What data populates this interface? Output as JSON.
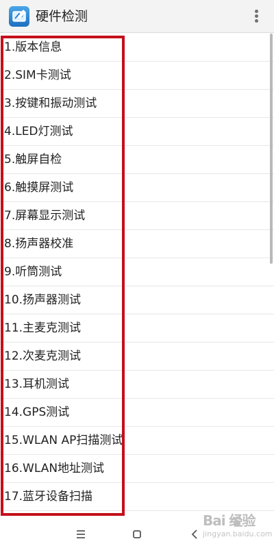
{
  "header": {
    "title": "硬件检测",
    "app_icon": "hardware-test-app-icon",
    "menu_icon": "overflow-menu-icon"
  },
  "list": {
    "items": [
      {
        "label": "1.版本信息"
      },
      {
        "label": "2.SIM卡测试"
      },
      {
        "label": "3.按键和振动测试"
      },
      {
        "label": "4.LED灯测试"
      },
      {
        "label": "5.触屏自检"
      },
      {
        "label": "6.触摸屏测试"
      },
      {
        "label": "7.屏幕显示测试"
      },
      {
        "label": "8.扬声器校准"
      },
      {
        "label": "9.听筒测试"
      },
      {
        "label": "10.扬声器测试"
      },
      {
        "label": "11.主麦克测试"
      },
      {
        "label": "12.次麦克测试"
      },
      {
        "label": "13.耳机测试"
      },
      {
        "label": "14.GPS测试"
      },
      {
        "label": "15.WLAN AP扫描测试"
      },
      {
        "label": "16.WLAN地址测试"
      },
      {
        "label": "17.蓝牙设备扫描"
      }
    ]
  },
  "navigation": {
    "menu_icon": "menu-icon",
    "home_icon": "home-square-icon",
    "back_icon": "back-chevron-icon"
  },
  "watermark": {
    "main": "Bai  经验",
    "sub": "jingyan.baidu.com"
  },
  "colors": {
    "highlight_border": "#c4101b",
    "header_background": "#f3f3f3",
    "text": "#222222"
  }
}
